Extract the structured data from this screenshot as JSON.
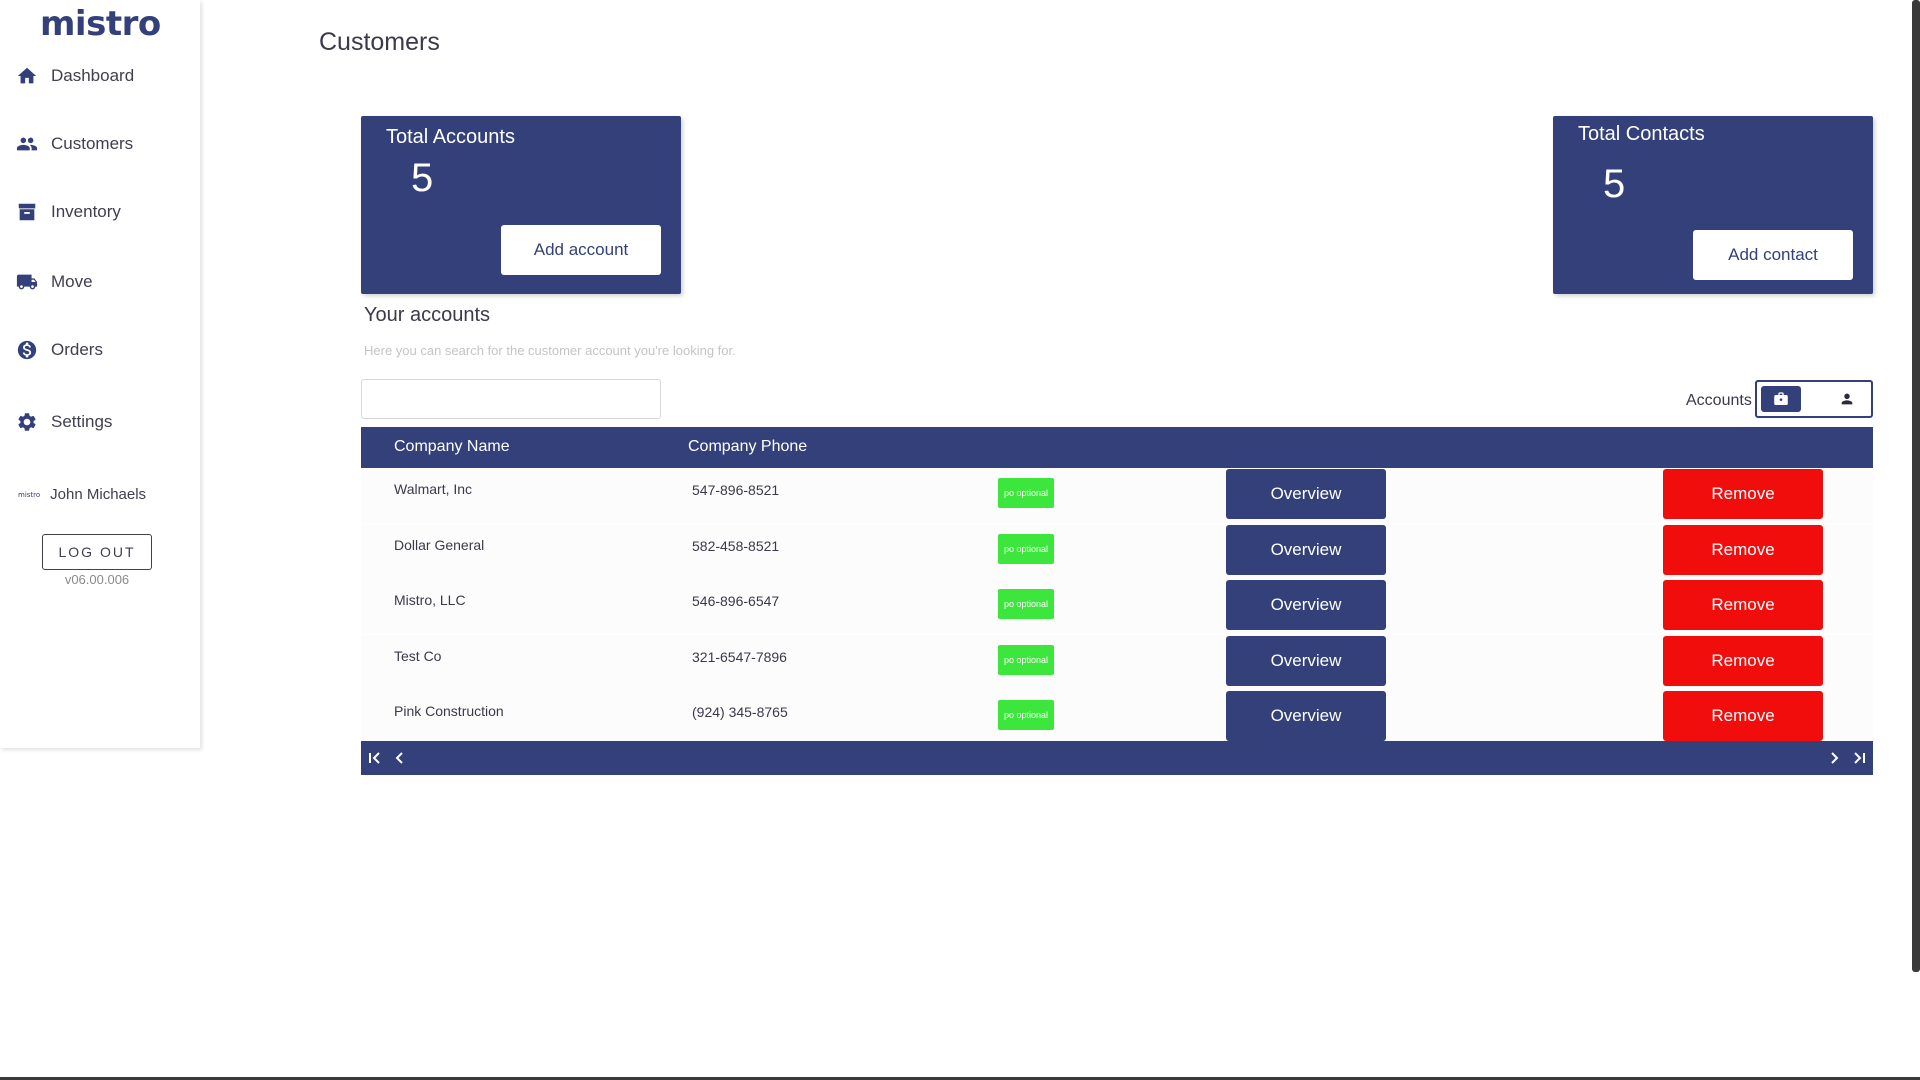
{
  "app": {
    "logo": "mistro",
    "version": "v06.00.006"
  },
  "sidebar": {
    "items": [
      {
        "label": "Dashboard",
        "icon": "home-icon"
      },
      {
        "label": "Customers",
        "icon": "people-icon"
      },
      {
        "label": "Inventory",
        "icon": "archive-icon"
      },
      {
        "label": "Move",
        "icon": "truck-icon"
      },
      {
        "label": "Orders",
        "icon": "dollar-icon"
      },
      {
        "label": "Settings",
        "icon": "gear-icon"
      }
    ],
    "user": {
      "avatar_text": "mistro",
      "name": "John Michaels"
    },
    "logout_label": "LOG OUT"
  },
  "page": {
    "title": "Customers"
  },
  "cards": {
    "accounts": {
      "label": "Total Accounts",
      "value": "5",
      "button": "Add account"
    },
    "contacts": {
      "label": "Total Contacts",
      "value": "5",
      "button": "Add contact"
    }
  },
  "section": {
    "title": "Your accounts",
    "subtitle": "Here you can search for the customer account you're looking for.",
    "search_value": "",
    "search_placeholder": "",
    "toggle_label": "Accounts"
  },
  "table": {
    "headers": [
      "Company Name",
      "Company Phone"
    ],
    "badge_label": "po optional",
    "overview_label": "Overview",
    "remove_label": "Remove",
    "rows": [
      {
        "name": "Walmart, Inc",
        "phone": "547-896-8521"
      },
      {
        "name": "Dollar General",
        "phone": "582-458-8521"
      },
      {
        "name": "Mistro, LLC",
        "phone": "546-896-6547"
      },
      {
        "name": "Test Co",
        "phone": "321-6547-7896"
      },
      {
        "name": "Pink Construction",
        "phone": "(924) 345-8765"
      }
    ]
  },
  "colors": {
    "primary": "#33407a",
    "danger": "#f20d0d",
    "badge": "#3ce63c"
  }
}
